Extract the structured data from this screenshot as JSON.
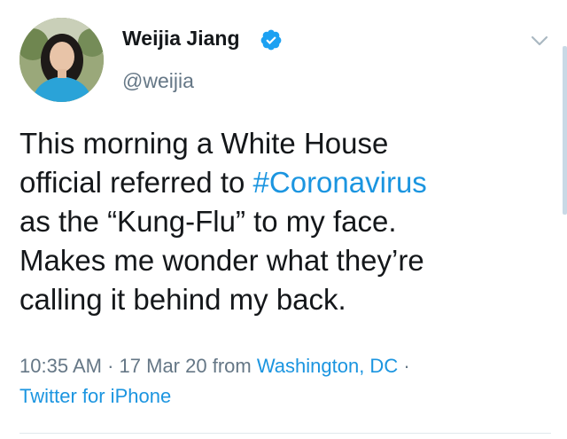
{
  "tweet": {
    "author": {
      "display_name": "Weijia Jiang",
      "handle": "@weijia",
      "verified": true,
      "avatar_icon": "profile-photo"
    },
    "text_lines": [
      {
        "before": "This morning a White House",
        "hashtag": "",
        "after": ""
      },
      {
        "before": "official referred to ",
        "hashtag": "#Coronavirus",
        "after": ""
      },
      {
        "before": "as the “Kung-Flu” to my face.",
        "hashtag": "",
        "after": ""
      },
      {
        "before": "Makes me wonder what they’re",
        "hashtag": "",
        "after": ""
      },
      {
        "before": "calling it behind my back.",
        "hashtag": "",
        "after": ""
      }
    ],
    "meta": {
      "time": "10:35 AM",
      "separator": "·",
      "date": "17 Mar 20",
      "from_label": "from",
      "location": "Washington, DC",
      "source": "Twitter for iPhone"
    }
  },
  "colors": {
    "link": "#1b95e0",
    "secondary_text": "#657786",
    "primary_text": "#14171a",
    "verified": "#1da1f2"
  }
}
